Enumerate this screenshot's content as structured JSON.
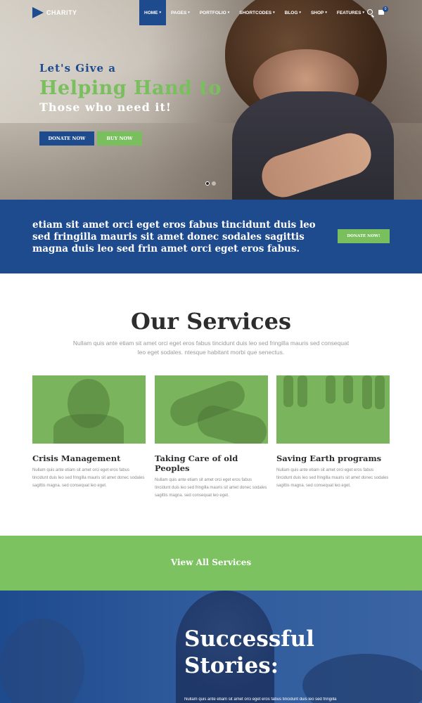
{
  "logo": {
    "text": "CHARITY"
  },
  "nav": {
    "items": [
      {
        "label": "HOME"
      },
      {
        "label": "PAGES"
      },
      {
        "label": "PORTFOLIO"
      },
      {
        "label": "SHORTCODES"
      },
      {
        "label": "BLOG"
      },
      {
        "label": "SHOP"
      },
      {
        "label": "FEATURES"
      }
    ],
    "cart_count": "0"
  },
  "hero": {
    "line1": "Let's Give a",
    "line2": "Helping Hand to",
    "line3": "Those who need it!",
    "donate_label": "DONATE NOW",
    "buy_label": "BUY NOW"
  },
  "band": {
    "text": "etiam sit amet orci eget eros fabus tincidunt duis leo sed fringilla mauris sit amet donec sodales sagittis magna duis leo sed frin amet orci eget eros fabus.",
    "button": "DONATE NOW!"
  },
  "services": {
    "title": "Our Services",
    "subtitle": "Nullam quis ante etiam sit amet orci eget eros fabus tincidunt duis leo sed fringilla mauris sed consequat leo eget sodales. ntesque habitant morbi que senectus.",
    "cards": [
      {
        "title": "Crisis Management",
        "text": "Nullam quis ante etiam sit amet orci eget eros fabus tincidunt duis leo sed fringilla mauris sit amet donec sodales sagittis magna. sed consequat leo eget."
      },
      {
        "title": "Taking Care of old Peoples",
        "text": "Nullam quis ante etiam sit amet orci eget eros fabus tincidunt duis leo sed fringilla mauris sit amet donec sodales sagittis magna. sed consequat leo eget."
      },
      {
        "title": "Saving Earth programs",
        "text": "Nullam quis ante etiam sit amet orci eget eros fabus tincidunt duis leo sed fringilla mauris sit amet donec sodales sagittis magna. sed consequat leo eget."
      }
    ],
    "view_all": "View All Services"
  },
  "stories": {
    "title_line1": "Successful",
    "title_line2": "Stories:",
    "text": "Nullam quis ante etiam sit amet orci eget eros fabus tincidunt duis leo sed fringilla"
  },
  "colors": {
    "blue": "#1e4a8e",
    "green": "#79bf5e"
  }
}
